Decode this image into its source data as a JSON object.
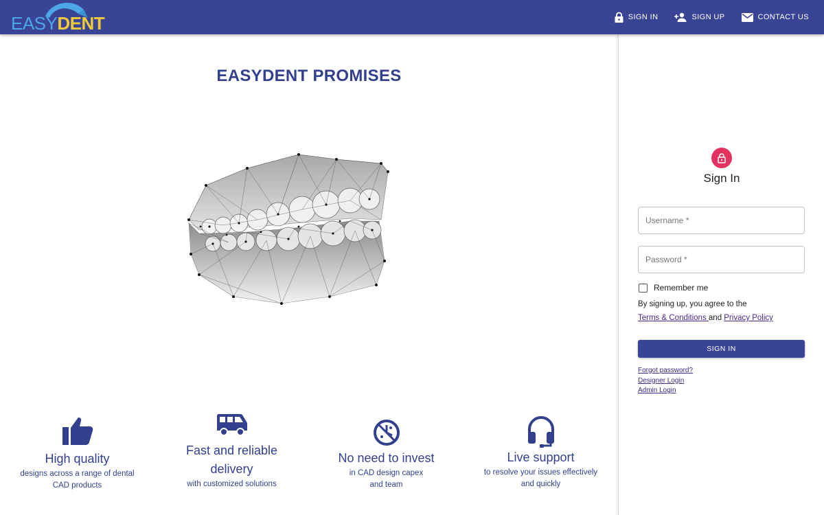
{
  "header": {
    "logo_easy": "EASY",
    "logo_dent": "DENT",
    "nav": [
      {
        "label": "SIGN IN",
        "icon": "lock-icon"
      },
      {
        "label": "SIGN UP",
        "icon": "person-add-icon"
      },
      {
        "label": "CONTACT US",
        "icon": "mail-icon"
      }
    ]
  },
  "main": {
    "title": "EASYDENT PROMISES",
    "features": [
      {
        "icon": "thumbs-up-icon",
        "title": "High quality",
        "sub1": "designs across a range of dental",
        "sub2": "CAD products"
      },
      {
        "icon": "van-icon",
        "title1": "Fast and reliable",
        "title2": "delivery",
        "sub1": "with customized solutions"
      },
      {
        "icon": "no-invest-icon",
        "title": "No need to invest",
        "sub1": "in CAD design capex",
        "sub2": "and team"
      },
      {
        "icon": "headset-icon",
        "title": "Live support",
        "sub1": "to resolve your issues effectively",
        "sub2": "and quickly"
      }
    ]
  },
  "signin": {
    "title": "Sign In",
    "username_placeholder": "Username *",
    "password_placeholder": "Password *",
    "remember_label": "Remember me",
    "terms_prefix": "By signing up, you agree to the",
    "terms_link": "Terms & Conditions ",
    "terms_and": "and",
    "privacy_link": "Privacy Policy",
    "button_label": "SIGN IN",
    "forgot_link": "Forgot password?",
    "designer_link": "Designer Login",
    "admin_link": "Admin Login"
  },
  "colors": {
    "header_bg": "#3a4495",
    "accent_text": "#33408e",
    "lock_badge": "#e3325f",
    "logo_blue": "#4da6e8",
    "logo_yellow": "#f0c93a"
  }
}
